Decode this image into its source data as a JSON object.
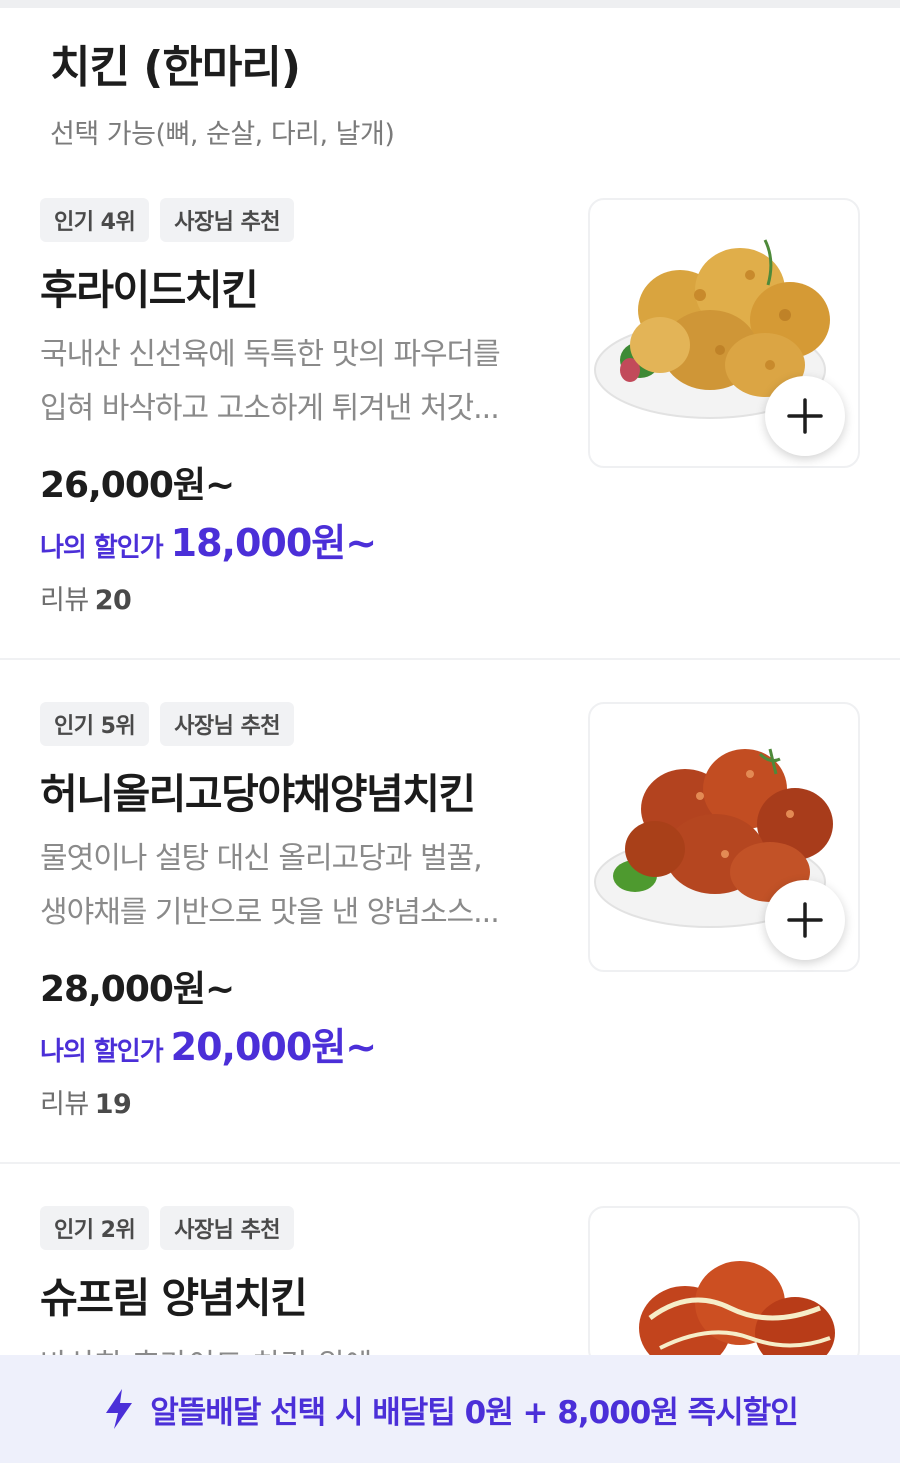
{
  "section": {
    "title": "치킨 (한마리)",
    "subtitle": "선택 가능(뼈, 순살, 다리, 날개)"
  },
  "items": [
    {
      "badges": [
        "인기 4위",
        "사장님 추천"
      ],
      "name": "후라이드치킨",
      "desc_line1": "국내산 신선육에 독특한 맛의 파우더를",
      "desc_line2": "입혀 바삭하고 고소하게 튀겨낸 처갓...",
      "price": "26,000원~",
      "discount_label": "나의 할인가",
      "discount_price": "18,000원~",
      "review_label": "리뷰",
      "review_count": "20",
      "image": "fried-chicken-photo"
    },
    {
      "badges": [
        "인기 5위",
        "사장님 추천"
      ],
      "name": "허니올리고당야채양념치킨",
      "desc_line1": "물엿이나 설탕 대신 올리고당과 벌꿀,",
      "desc_line2": "생야채를 기반으로 맛을 낸 양념소스...",
      "price": "28,000원~",
      "discount_label": "나의 할인가",
      "discount_price": "20,000원~",
      "review_label": "리뷰",
      "review_count": "19",
      "image": "seasoned-chicken-photo"
    },
    {
      "badges": [
        "인기 2위",
        "사장님 추천"
      ],
      "name": "슈프림 양념치킨",
      "desc_line1": "바삭한 후라이드 치킨 위에",
      "image": "supreme-chicken-photo"
    }
  ],
  "promo": {
    "text": "알뜰배달 선택 시 배달팁 0원 + 8,000원 즉시할인",
    "icon": "lightning-icon"
  },
  "colors": {
    "accent": "#4b2fd8",
    "badge_bg": "#f1f2f4",
    "promo_bg": "#eef0fb"
  }
}
